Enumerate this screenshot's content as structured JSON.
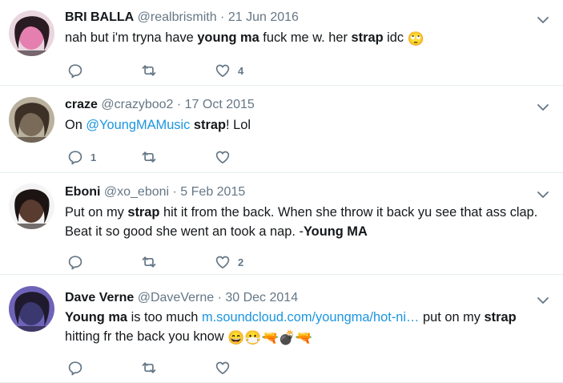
{
  "tweets": [
    {
      "fullname": "BRI BALLA",
      "handle": "@realbrismith",
      "date": "21 Jun 2016",
      "body": [
        {
          "t": "nah but i'm tryna have "
        },
        {
          "t": "young ma",
          "b": true
        },
        {
          "t": " fuck me w. her "
        },
        {
          "t": "strap",
          "b": true
        },
        {
          "t": " idc "
        },
        {
          "e": "🙄",
          "name": "eye-roll-emoji"
        }
      ],
      "reply_count": "",
      "retweet_count": "",
      "like_count": "4",
      "avatar_colors": [
        "#e9d6de",
        "#2a1a22",
        "#e57fb0"
      ]
    },
    {
      "fullname": "craze",
      "handle": "@crazyboo2",
      "date": "17 Oct 2015",
      "body": [
        {
          "t": "On "
        },
        {
          "t": "@YoungMAMusic",
          "link": true
        },
        {
          "t": "  "
        },
        {
          "t": "strap",
          "b": true
        },
        {
          "t": "! Lol"
        }
      ],
      "reply_count": "1",
      "retweet_count": "",
      "like_count": "",
      "avatar_colors": [
        "#b9b19d",
        "#3d3127",
        "#7a6a58"
      ]
    },
    {
      "fullname": "Eboni",
      "handle": "@xo_eboni",
      "date": "5 Feb 2015",
      "body": [
        {
          "t": "Put on my "
        },
        {
          "t": "strap",
          "b": true
        },
        {
          "t": " hit it from the back. When she throw it back yu see that ass clap. Beat it so good she went an took a nap. -"
        },
        {
          "t": "Young MA",
          "b": true
        }
      ],
      "reply_count": "",
      "retweet_count": "",
      "like_count": "2",
      "avatar_colors": [
        "#f4f4f4",
        "#1c1412",
        "#5a3b30"
      ]
    },
    {
      "fullname": "Dave Verne",
      "handle": "@DaveVerne",
      "date": "30 Dec 2014",
      "body": [
        {
          "t": "Young ma",
          "b": true
        },
        {
          "t": " is too much "
        },
        {
          "t": "m.soundcloud.com/youngma/hot-ni…",
          "link": true
        },
        {
          "t": " put on my "
        },
        {
          "t": "strap",
          "b": true
        },
        {
          "t": " hitting fr the back you know "
        },
        {
          "e": "😄",
          "name": "grinning-emoji"
        },
        {
          "e": "😷",
          "name": "mask-emoji"
        },
        {
          "e": "🔫",
          "name": "pistol-emoji"
        },
        {
          "e": "💣",
          "name": "bomb-emoji"
        },
        {
          "e": "🔫",
          "name": "pistol-emoji"
        }
      ],
      "reply_count": "",
      "retweet_count": "",
      "like_count": "",
      "avatar_colors": [
        "#6e63b8",
        "#1f1a2e",
        "#3b3870"
      ]
    }
  ],
  "colors": {
    "text": "#14171a",
    "secondary": "#657786",
    "link": "#1b95e0",
    "divider": "#e6ecf0"
  },
  "icons": {
    "reply": "reply-icon",
    "retweet": "retweet-icon",
    "like": "heart-icon",
    "caret": "chevron-down-icon"
  }
}
